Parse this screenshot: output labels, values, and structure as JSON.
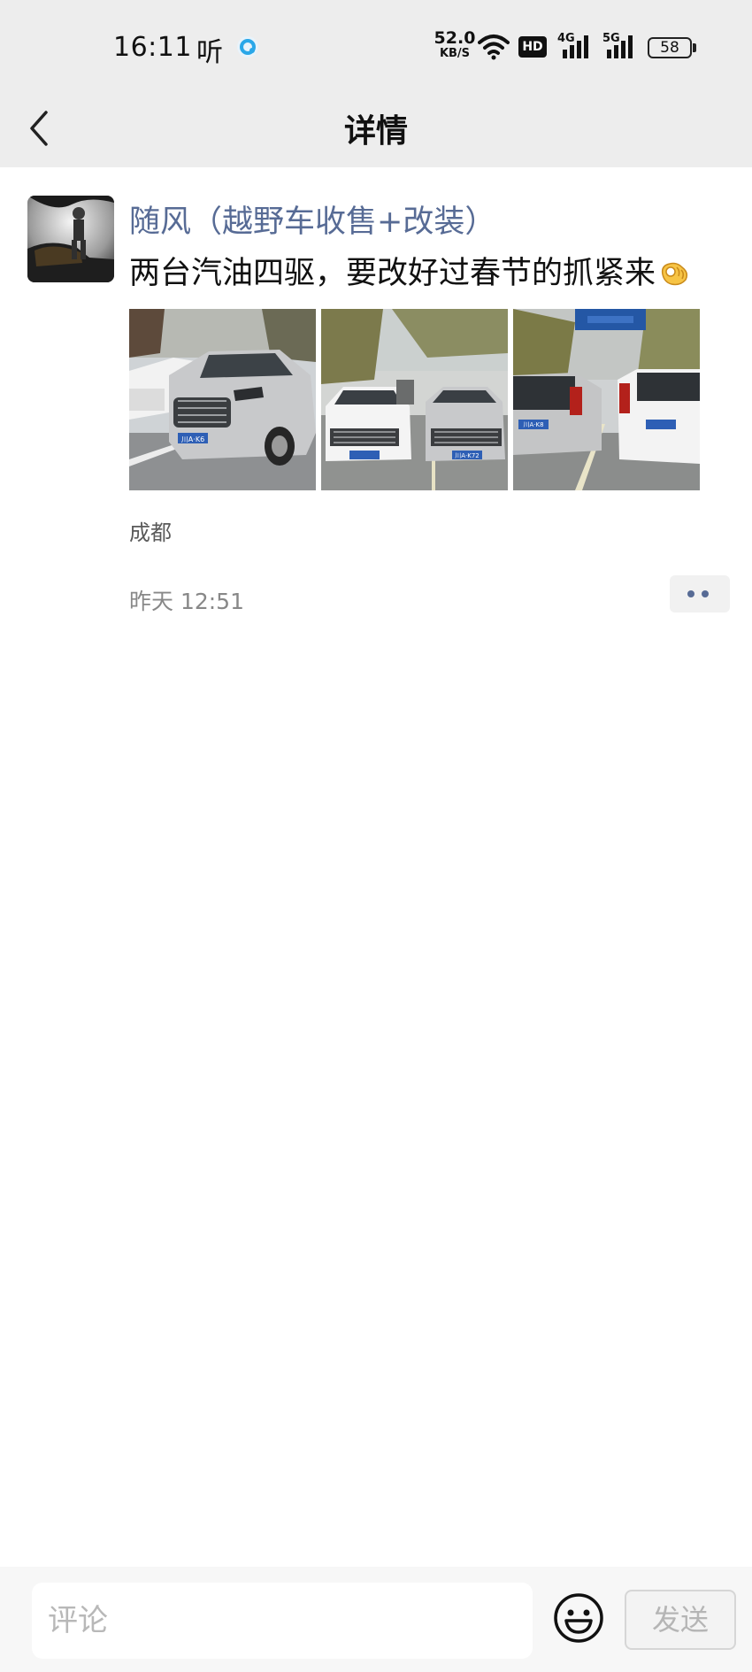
{
  "status_bar": {
    "time": "16:11",
    "listen_label": "听",
    "net_speed_value": "52.0",
    "net_speed_unit": "KB/S",
    "hd_label": "HD",
    "signal1_label": "4G",
    "signal2_label": "5G",
    "battery": "58"
  },
  "nav": {
    "title": "详情",
    "back_icon": "chevron-left-icon"
  },
  "post": {
    "author": "随风（越野车收售+改装）",
    "text": "两台汽油四驱，要改好过春节的抓紧来",
    "emoji": "ok-hand-emoji",
    "photos": [
      {
        "plate": "川A·K6"
      },
      {
        "plate": "川A·K72"
      },
      {
        "plate": "川A·K8"
      }
    ],
    "location": "成都",
    "time": "昨天 12:51"
  },
  "bottom_bar": {
    "comment_placeholder": "评论",
    "send_label": "发送",
    "face_icon": "smiley-face-icon"
  },
  "colors": {
    "link": "#576b95",
    "header_bg": "#ededed",
    "bottom_bg": "#f7f7f7"
  }
}
